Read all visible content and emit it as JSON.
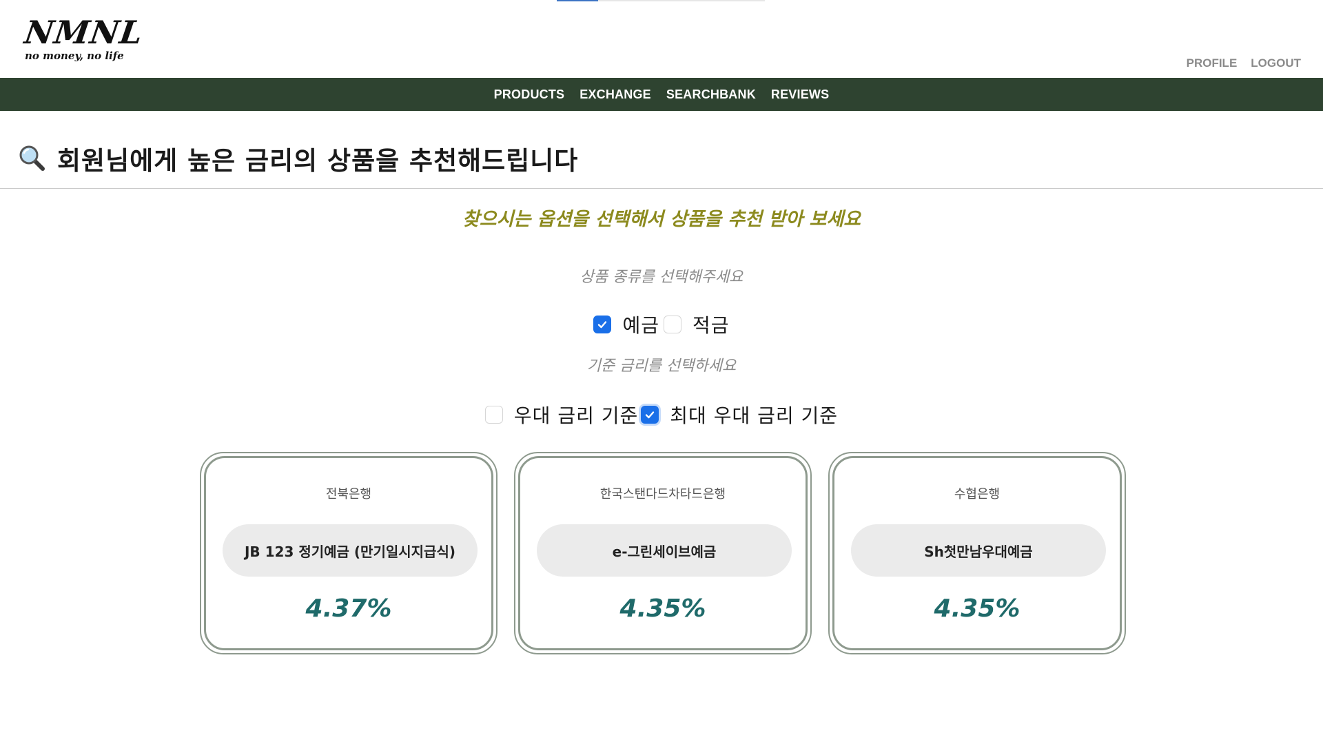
{
  "logo": {
    "main": "NMNL",
    "sub": "no money, no life"
  },
  "user_links": [
    "PROFILE",
    "LOGOUT"
  ],
  "nav": {
    "items": [
      "PRODUCTS",
      "EXCHANGE",
      "SEARCHBANK",
      "REVIEWS"
    ]
  },
  "page": {
    "icon": "magnifier-icon",
    "title": "회원님에게 높은 금리의 상품을 추천해드립니다",
    "subtitle": "찾으시는 옵션을 선택해서 상품을 추천 받아 보세요"
  },
  "product_type": {
    "label": "상품 종류를 선택해주세요",
    "options": [
      {
        "label": "예금",
        "checked": true
      },
      {
        "label": "적금",
        "checked": false
      }
    ]
  },
  "rate_basis": {
    "label": "기준 금리를 선택하세요",
    "options": [
      {
        "label": "우대 금리 기준",
        "checked": false
      },
      {
        "label": "최대 우대 금리 기준",
        "checked": true
      }
    ]
  },
  "results": [
    {
      "bank": "전북은행",
      "product": "JB 123 정기예금 (만기일시지급식)",
      "rate": "4.37%"
    },
    {
      "bank": "한국스탠다드차타드은행",
      "product": "e-그린세이브예금",
      "rate": "4.35%"
    },
    {
      "bank": "수협은행",
      "product": "Sh첫만남우대예금",
      "rate": "4.35%"
    }
  ],
  "colors": {
    "nav_bg": "#2e4330",
    "subtitle": "#8c8a1e",
    "rate": "#1f6a6a",
    "checkbox_checked": "#1a6fe8",
    "card_border": "#8e9a8e"
  }
}
